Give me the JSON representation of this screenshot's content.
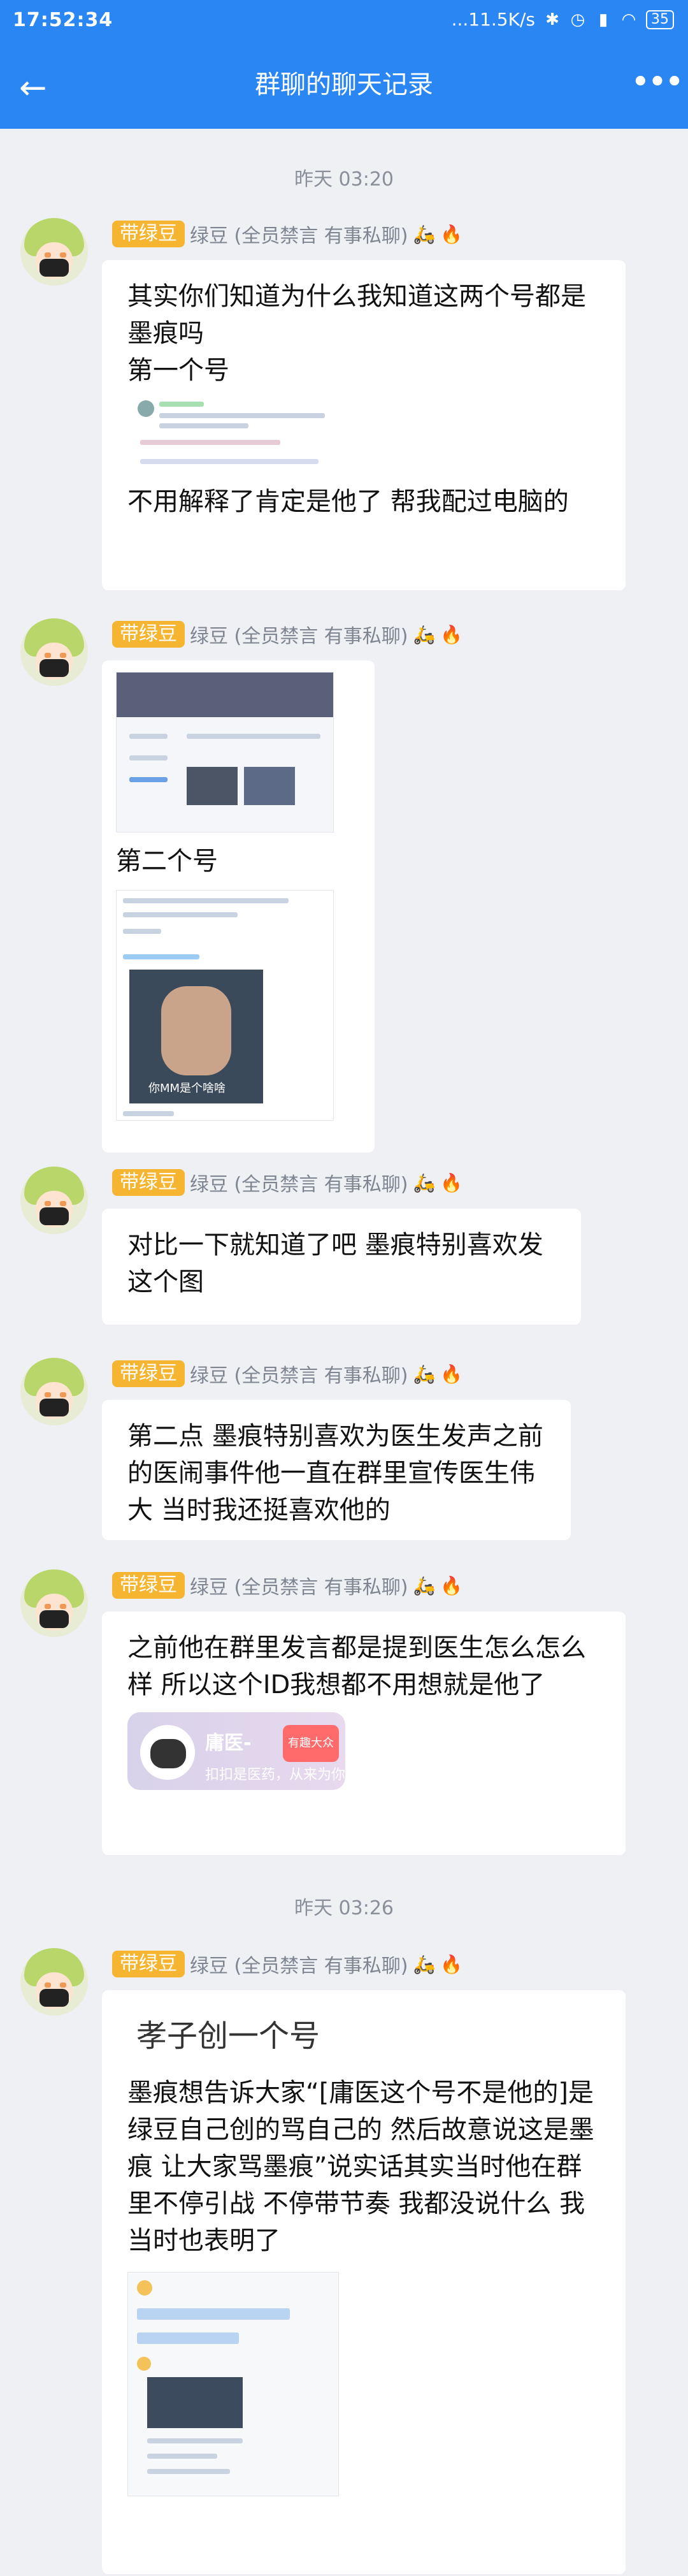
{
  "status_bar": {
    "time": "17:52:34",
    "network": "...11.5K/s",
    "battery": "35"
  },
  "header": {
    "title": "群聊的聊天记录",
    "back_icon": "arrow-left-icon",
    "more_icon": "more-dots-icon"
  },
  "timestamps": [
    "昨天 03:20",
    "昨天 03:26"
  ],
  "sender": {
    "tag": "带绿豆",
    "name": "绿豆 (全员禁言 有事私聊)"
  },
  "messages": [
    {
      "text1": "其实你们知道为什么我知道这两个号都是墨痕吗",
      "text2": "第一个号",
      "text3": "不用解释了肯定是他了 帮我配过电脑的"
    },
    {
      "text1": "第二个号",
      "img_caption": "你MM是个啥啥"
    },
    {
      "text1": "对比一下就知道了吧 墨痕特别喜欢发这个图"
    },
    {
      "text1": "第二点 墨痕特别喜欢为医生发声之前的医闹事件他一直在群里宣传医生伟大 当时我还挺喜欢他的"
    },
    {
      "text1": "之前他在群里发言都是提到医生怎么怎么样 所以这个ID我想都不用想就是他了",
      "card_name": "庸医-",
      "card_sub": "扣扣是医药，从来为你来",
      "card_tag": "有趣大众"
    },
    {
      "img_text": "孝子创一个号",
      "text1": "墨痕想告诉大家“[庸医这个号不是他的]是绿豆自己创的骂自己的 然后故意说这是墨痕 让大家骂墨痕”说实话其实当时他在群里不停引战 不停带节奏 我都没说什么 我当时也表明了"
    }
  ]
}
